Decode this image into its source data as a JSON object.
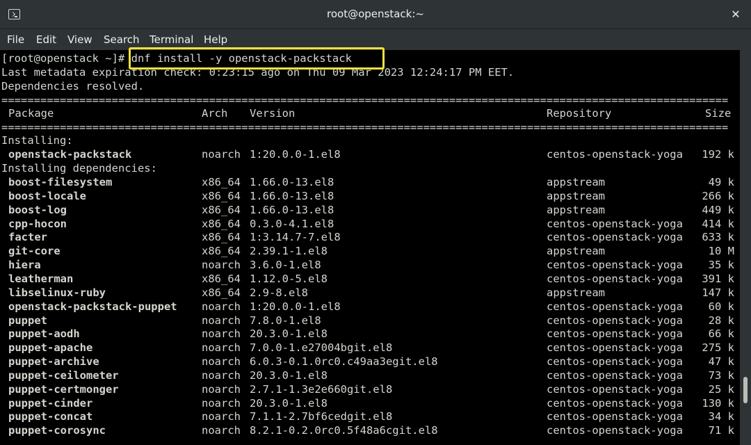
{
  "window": {
    "title": "root@openstack:~",
    "close_label": "✕"
  },
  "menu": [
    "File",
    "Edit",
    "View",
    "Search",
    "Terminal",
    "Help"
  ],
  "prompt": "[root@openstack ~]# ",
  "command": "dnf install -y openstack-packstack",
  "meta_line": "Last metadata expiration check: 0:23:15 ago on Thu 09 Mar 2023 12:24:17 PM EET.",
  "deps_line": "Dependencies resolved.",
  "separator": "================================================================================================================",
  "headers": {
    "package": "Package",
    "arch": "Arch",
    "version": "Version",
    "repository": "Repository",
    "size": "Size"
  },
  "installing_label": "Installing:",
  "deps_label": "Installing dependencies:",
  "main_package": {
    "name": "openstack-packstack",
    "arch": "noarch",
    "version": "1:20.0.0-1.el8",
    "repo": "centos-openstack-yoga",
    "size": "192 k"
  },
  "dependencies": [
    {
      "name": "boost-filesystem",
      "arch": "x86_64",
      "version": "1.66.0-13.el8",
      "repo": "appstream",
      "size": "49 k"
    },
    {
      "name": "boost-locale",
      "arch": "x86_64",
      "version": "1.66.0-13.el8",
      "repo": "appstream",
      "size": "266 k"
    },
    {
      "name": "boost-log",
      "arch": "x86_64",
      "version": "1.66.0-13.el8",
      "repo": "appstream",
      "size": "449 k"
    },
    {
      "name": "cpp-hocon",
      "arch": "x86_64",
      "version": "0.3.0-4.1.el8",
      "repo": "centos-openstack-yoga",
      "size": "414 k"
    },
    {
      "name": "facter",
      "arch": "x86_64",
      "version": "1:3.14.7-7.el8",
      "repo": "centos-openstack-yoga",
      "size": "633 k"
    },
    {
      "name": "git-core",
      "arch": "x86_64",
      "version": "2.39.1-1.el8",
      "repo": "appstream",
      "size": "10 M"
    },
    {
      "name": "hiera",
      "arch": "noarch",
      "version": "3.6.0-1.el8",
      "repo": "centos-openstack-yoga",
      "size": "35 k"
    },
    {
      "name": "leatherman",
      "arch": "x86_64",
      "version": "1.12.0-5.el8",
      "repo": "centos-openstack-yoga",
      "size": "391 k"
    },
    {
      "name": "libselinux-ruby",
      "arch": "x86_64",
      "version": "2.9-8.el8",
      "repo": "appstream",
      "size": "147 k"
    },
    {
      "name": "openstack-packstack-puppet",
      "arch": "noarch",
      "version": "1:20.0.0-1.el8",
      "repo": "centos-openstack-yoga",
      "size": "60 k"
    },
    {
      "name": "puppet",
      "arch": "noarch",
      "version": "7.8.0-1.el8",
      "repo": "centos-openstack-yoga",
      "size": "28 k"
    },
    {
      "name": "puppet-aodh",
      "arch": "noarch",
      "version": "20.3.0-1.el8",
      "repo": "centos-openstack-yoga",
      "size": "66 k"
    },
    {
      "name": "puppet-apache",
      "arch": "noarch",
      "version": "7.0.0-1.e27004bgit.el8",
      "repo": "centos-openstack-yoga",
      "size": "275 k"
    },
    {
      "name": "puppet-archive",
      "arch": "noarch",
      "version": "6.0.3-0.1.0rc0.c49aa3egit.el8",
      "repo": "centos-openstack-yoga",
      "size": "47 k"
    },
    {
      "name": "puppet-ceilometer",
      "arch": "noarch",
      "version": "20.3.0-1.el8",
      "repo": "centos-openstack-yoga",
      "size": "73 k"
    },
    {
      "name": "puppet-certmonger",
      "arch": "noarch",
      "version": "2.7.1-1.3e2e660git.el8",
      "repo": "centos-openstack-yoga",
      "size": "25 k"
    },
    {
      "name": "puppet-cinder",
      "arch": "noarch",
      "version": "20.3.0-1.el8",
      "repo": "centos-openstack-yoga",
      "size": "130 k"
    },
    {
      "name": "puppet-concat",
      "arch": "noarch",
      "version": "7.1.1-2.7bf6cedgit.el8",
      "repo": "centos-openstack-yoga",
      "size": "34 k"
    },
    {
      "name": "puppet-corosync",
      "arch": "noarch",
      "version": "8.2.1-0.2.0rc0.5f48a6cgit.el8",
      "repo": "centos-openstack-yoga",
      "size": "71 k"
    }
  ]
}
